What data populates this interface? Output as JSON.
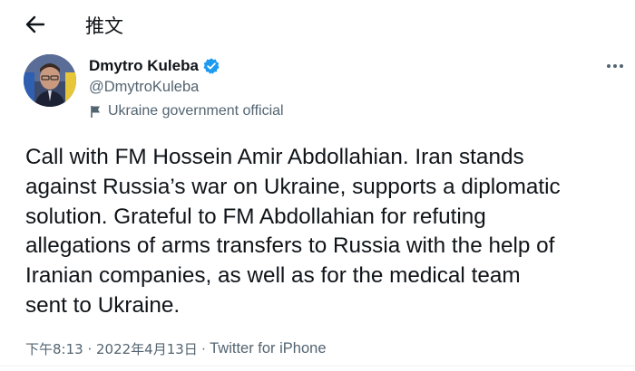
{
  "header": {
    "title": "推文",
    "back_icon": "arrow-left-icon"
  },
  "author": {
    "display_name": "Dmytro Kuleba",
    "handle": "@DmytroKuleba",
    "verified": true,
    "verified_color": "#1d9bf0",
    "label": "Ukraine government official",
    "label_icon": "flag-icon"
  },
  "tweet": {
    "text": "Call with FM Hossein Amir Abdollahian. Iran stands\nagainst Russia’s war on Ukraine, supports a diplomatic\nsolution. Grateful to FM Abdollahian for refuting\nallegations of arms transfers to Russia with the help of\nIranian companies, as well as for the medical team\nsent to Ukraine.",
    "timestamp": "下午8:13 · 2022年4月13日",
    "separator": "·",
    "source": "Twitter for iPhone"
  },
  "more_icon": "more-horizontal-icon",
  "colors": {
    "text": "#0f1419",
    "secondary": "#536471",
    "accent": "#1d9bf0"
  }
}
